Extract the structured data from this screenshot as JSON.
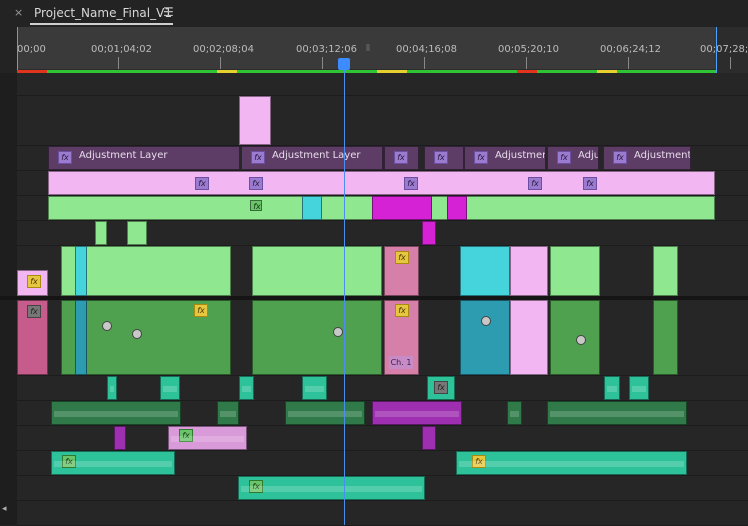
{
  "tab": {
    "close_icon": "×",
    "title": "Project_Name_Final_V1",
    "menu_icon": "☰"
  },
  "ruler": {
    "timecodes": [
      "00;00",
      "00;01;04;02",
      "00;02;08;04",
      "00;03;12;06",
      "00;04;16;08",
      "00;05;20;10",
      "00;06;24;12",
      "00;07;28;1"
    ],
    "playhead_time": "00;03;12;06",
    "mid_marker": "⦀"
  },
  "timeline": {
    "adjustment_labels": [
      "Adjustment Layer",
      "Adjustment Layer",
      "Adjustment",
      "Adju",
      "Adjustment L"
    ],
    "fx_label": "fx",
    "clip_channel_label": "Ch. 1",
    "scroll_left_icon": "◂"
  },
  "colors": {
    "adjustment": "#5d3c66",
    "video_pink": "#f2b7f2",
    "video_green": "#8fe88f",
    "video_cyan": "#45d4dc",
    "video_magenta": "#d522d5",
    "audio_teal": "#2ec29a",
    "audio_dark_green": "#2f7a48",
    "playhead": "#3c8cff",
    "render_red": "#e0341c",
    "render_green": "#2fc433",
    "render_yellow": "#e5d02f"
  }
}
